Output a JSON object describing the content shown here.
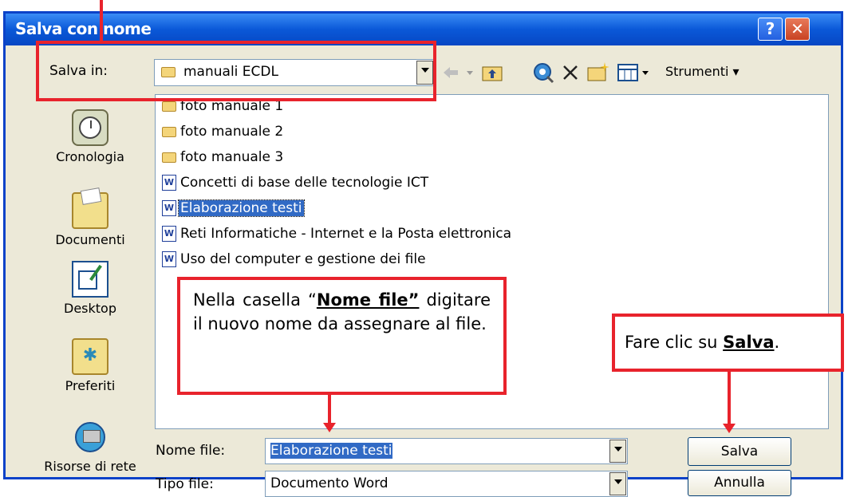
{
  "dialog": {
    "title": "Salva con nome",
    "help_label": "?",
    "close_label": "✕"
  },
  "toolbar": {
    "save_in_label": "Salva in:",
    "save_in_value": "manuali ECDL",
    "tools_label": "Strumenti ▾"
  },
  "places": [
    {
      "label": "Cronologia",
      "icon": "history-icon"
    },
    {
      "label": "Documenti",
      "icon": "my-documents-icon"
    },
    {
      "label": "Desktop",
      "icon": "desktop-icon"
    },
    {
      "label": "Preferiti",
      "icon": "favorites-icon"
    },
    {
      "label": "Risorse di rete",
      "icon": "network-places-icon"
    }
  ],
  "files": [
    {
      "name": "foto manuale 1",
      "type": "folder"
    },
    {
      "name": "foto manuale 2",
      "type": "folder"
    },
    {
      "name": "foto manuale 3",
      "type": "folder"
    },
    {
      "name": "Concetti di base delle tecnologie ICT",
      "type": "word"
    },
    {
      "name": "Elaborazione testi",
      "type": "word",
      "selected": true
    },
    {
      "name": "Reti Informatiche - Internet e la Posta elettronica",
      "type": "word"
    },
    {
      "name": "Uso del computer e gestione dei file",
      "type": "word"
    }
  ],
  "form": {
    "filename_label": "Nome file:",
    "filename_value": "Elaborazione testi",
    "filetype_label": "Tipo file:",
    "filetype_value": "Documento Word",
    "save_button": "Salva",
    "cancel_button": "Annulla"
  },
  "annotations": {
    "filename_note_1": "Nella casella “",
    "filename_note_bold": "Nome file”",
    "filename_note_2": "digitare il nuovo nome da assegnare al file.",
    "save_note_1": "Fare clic su ",
    "save_note_bold": "Salva",
    "save_note_2": "."
  },
  "colors": {
    "titlebar": "#0a58d8",
    "selection": "#316ac5",
    "annotation": "#e8232c"
  }
}
